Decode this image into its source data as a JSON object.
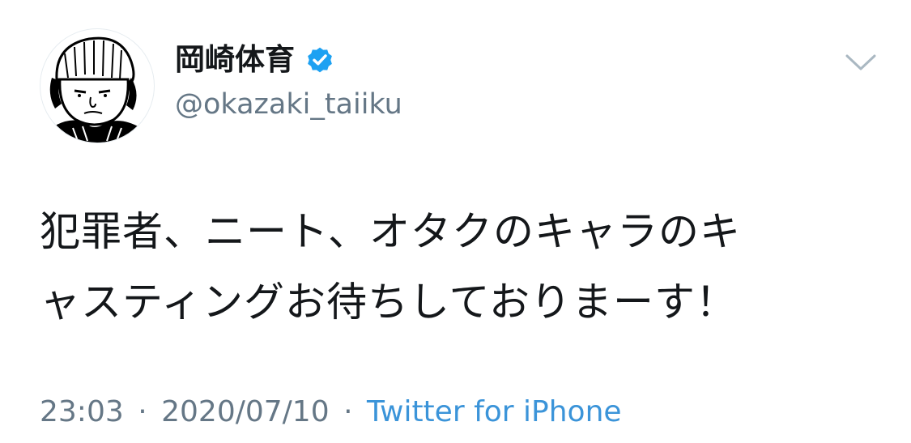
{
  "author": {
    "display_name": "岡崎体育",
    "handle": "@okazaki_taiiku",
    "verified": true,
    "avatar_icon": "cartoon-face-beanie-avatar"
  },
  "menu": {
    "icon": "chevron-down-icon"
  },
  "tweet": {
    "lines": [
      "犯罪者、ニート、オタクのキャラのキ",
      "ャスティングお待ちしておりまーす！"
    ]
  },
  "meta": {
    "time": "23:03",
    "separator": "·",
    "date": "2020/07/10",
    "source": "Twitter for iPhone"
  },
  "colors": {
    "text": "#14171a",
    "secondary": "#657786",
    "link": "#3b94d9",
    "verified": "#1da1f2"
  }
}
